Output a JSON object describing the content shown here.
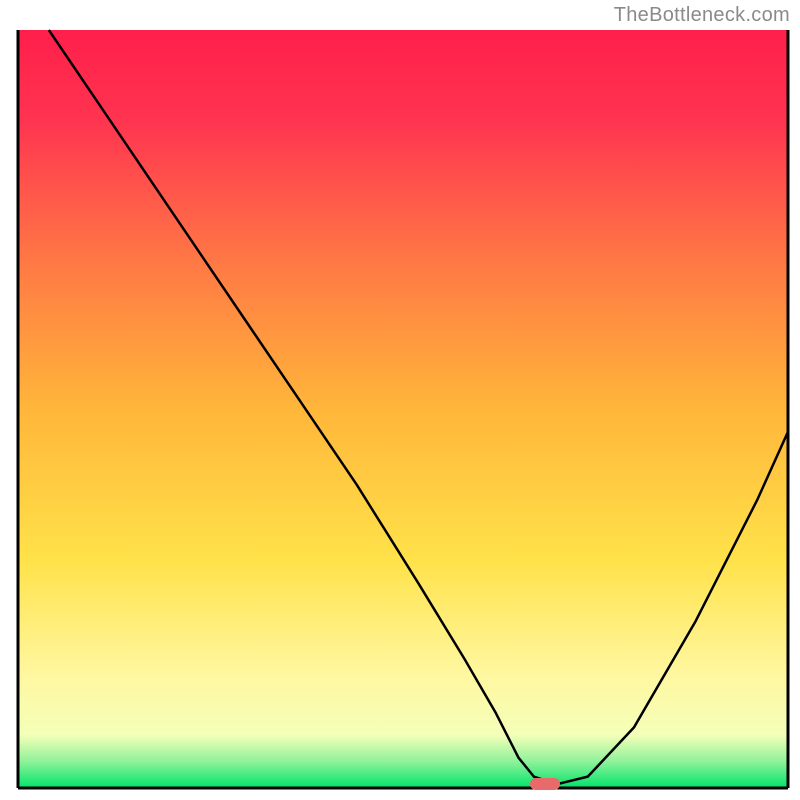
{
  "watermark": "TheBottleneck.com",
  "chart_data": {
    "type": "line",
    "title": "",
    "xlabel": "",
    "ylabel": "",
    "xlim": [
      0,
      100
    ],
    "ylim": [
      0,
      100
    ],
    "legend": false,
    "grid": false,
    "background": {
      "type": "vertical-gradient",
      "description": "Red at top through orange/yellow to pale yellow, with a thin bright green band at the very bottom",
      "stops": [
        {
          "pos": 0.0,
          "color": "#ff1f4b"
        },
        {
          "pos": 0.12,
          "color": "#ff3450"
        },
        {
          "pos": 0.3,
          "color": "#ff7645"
        },
        {
          "pos": 0.5,
          "color": "#ffb63a"
        },
        {
          "pos": 0.7,
          "color": "#ffe24a"
        },
        {
          "pos": 0.85,
          "color": "#fff7a0"
        },
        {
          "pos": 0.93,
          "color": "#f4ffb8"
        },
        {
          "pos": 0.965,
          "color": "#8ff29a"
        },
        {
          "pos": 1.0,
          "color": "#00e46a"
        }
      ]
    },
    "series": [
      {
        "name": "bottleneck-curve",
        "stroke": "#000000",
        "stroke_width": 2,
        "x": [
          4,
          12,
          18,
          24,
          30,
          36,
          44,
          52,
          58,
          62,
          65,
          67,
          70,
          74,
          80,
          88,
          96,
          100
        ],
        "y": [
          100,
          88,
          79,
          70,
          61,
          52,
          40,
          27,
          17,
          10,
          4,
          1.5,
          0.5,
          1.5,
          8,
          22,
          38,
          47
        ]
      }
    ],
    "marker": {
      "name": "optimal-point",
      "x": 68,
      "y": 0.5,
      "shape": "rounded-rect",
      "fill": "#e86a6a",
      "width_pct": 3.2,
      "height_pct": 1.6
    },
    "frame": {
      "top": true,
      "right": true,
      "bottom": true,
      "left": true,
      "color": "#000000",
      "width": 2
    }
  }
}
